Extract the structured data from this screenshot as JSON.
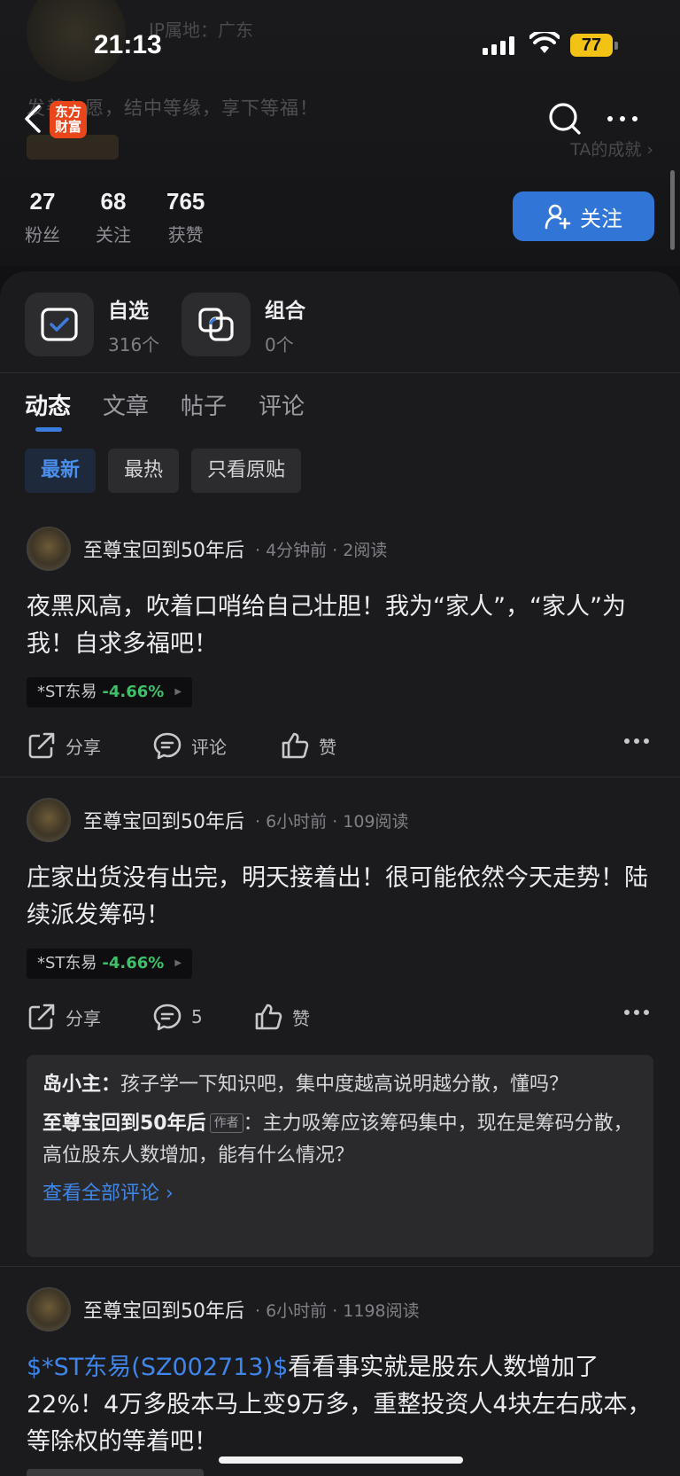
{
  "status_bar": {
    "time": "21:13",
    "battery": "77"
  },
  "header": {
    "brand": "东方\n财富",
    "location": "IP属地：广东",
    "motto": "发善心愿，结中等缘，享下等福！",
    "achievements": "TA的成就 ›",
    "follow_label": "关注"
  },
  "stats": [
    {
      "value": "27",
      "label": "粉丝"
    },
    {
      "value": "68",
      "label": "关注"
    },
    {
      "value": "765",
      "label": "获赞"
    }
  ],
  "portfolio": [
    {
      "title": "自选",
      "sub": "316个"
    },
    {
      "title": "组合",
      "sub": "0个"
    }
  ],
  "tabs": [
    "动态",
    "文章",
    "帖子",
    "评论"
  ],
  "filters": [
    "最新",
    "最热",
    "只看原贴"
  ],
  "posts": [
    {
      "author": "至尊宝回到50年后",
      "meta": "· 4分钟前 · 2阅读",
      "body": "夜黑风高，吹着口哨给自己壮胆！我为“家人”，“家人”为我！自求多福吧！",
      "stock": {
        "name": "*ST东易",
        "change": "-4.66%"
      },
      "actions": {
        "share": "分享",
        "comment": "评论",
        "like": "赞"
      }
    },
    {
      "author": "至尊宝回到50年后",
      "meta": "· 6小时前 · 109阅读",
      "body": "庄家出货没有出完，明天接着出！很可能依然今天走势！陆续派发筹码！",
      "stock": {
        "name": "*ST东易",
        "change": "-4.66%"
      },
      "actions": {
        "share": "分享",
        "comment": "5",
        "like": "赞"
      },
      "comments": [
        {
          "name": "岛小主：",
          "text": "孩子学一下知识吧，集中度越高说明越分散，懂吗？"
        },
        {
          "name": "至尊宝回到50年后",
          "tag": "作者",
          "text": "：主力吸筹应该筹码集中，现在是筹码分散，高位股东人数增加，能有什么情况？"
        }
      ],
      "view_all": "查看全部评论 ›"
    },
    {
      "author": "至尊宝回到50年后",
      "meta": "· 6小时前 · 1198阅读",
      "link": "$*ST东易(SZ002713)$",
      "body": "看看事实就是股东人数增加了22%！4万多股本马上变9万多，重整投资人4块左右成本，等除权的等着吧！"
    }
  ],
  "colors": {
    "accent": "#3176d6",
    "link": "#3f86ea",
    "down": "#3fbf6a",
    "brand": "#e9461c"
  }
}
